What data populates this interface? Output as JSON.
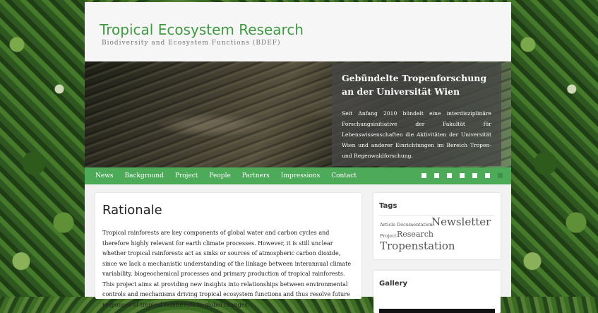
{
  "site": {
    "title": "Tropical Ecosystem Research",
    "subtitle": "Biodiversity and Ecosystem Functions (BDEF)"
  },
  "hero": {
    "title": "Gebündelte Tropenforschung an der Universität Wien",
    "text": "Seit Anfang 2010 bündelt eine interdisziplinäre Forschungsinitiative der Fakultät für Lebenswissenschaften die Aktivitäten der Universität Wien und anderer Einrichtungen im Bereich Tropen- und Regenwaldforschung."
  },
  "nav": {
    "items": [
      "News",
      "Background",
      "Project",
      "People",
      "Partners",
      "Impressions",
      "Contact"
    ],
    "slide_count": 7,
    "active_slide": 7
  },
  "content": {
    "heading": "Rationale",
    "body": "Tropical rainforests are key components of global water and carbon cycles and therefore highly relevant for earth climate processes. However, it is still unclear whether tropical rainforests act as sinks or sources of atmospheric carbon dioxide, since we lack a mechanistic understanding of the linkage between interannual climate variability, biogeochemical processes and primary production of tropical rainforests. This project aims at providing new insights into relationships between environmental controls and mechanisms driving tropical ecosystem functions and thus resolve future responses of tropical rainforests to global changes."
  },
  "sidebar": {
    "tags_title": "Tags",
    "tags": {
      "article": "Article",
      "documentation": "Documentation",
      "newsletter": "Newsletter",
      "project": "Project",
      "research": "Research",
      "tropenstation": "Tropenstation"
    },
    "gallery_title": "Gallery"
  },
  "colors": {
    "brand_green": "#3e9a41",
    "nav_green": "#4caa59"
  }
}
